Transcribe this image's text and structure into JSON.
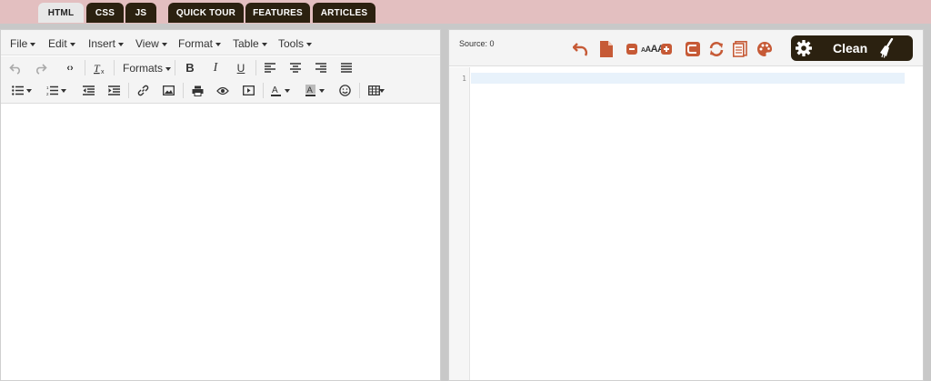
{
  "tabs": [
    {
      "label": "HTML",
      "active": true
    },
    {
      "label": "CSS",
      "active": false
    },
    {
      "label": "JS",
      "active": false
    },
    {
      "label": "QUICK TOUR",
      "active": false
    },
    {
      "label": "FEATURES",
      "active": false
    },
    {
      "label": "ARTICLES",
      "active": false
    }
  ],
  "menu": [
    "File",
    "Edit",
    "Insert",
    "View",
    "Format",
    "Table",
    "Tools"
  ],
  "toolbar": {
    "formats_label": "Formats",
    "icons_row1": [
      "undo-icon",
      "redo-icon",
      "source-code-icon",
      "clear-formatting-icon",
      "bold-icon",
      "italic-icon",
      "underline-icon",
      "align-left-icon",
      "align-center-icon",
      "align-right-icon",
      "justify-icon"
    ],
    "icons_row2": [
      "bullet-list-icon",
      "numbered-list-icon",
      "outdent-icon",
      "indent-icon",
      "link-icon",
      "image-icon",
      "print-icon",
      "preview-icon",
      "media-icon",
      "text-color-icon",
      "background-color-icon",
      "emoticons-icon",
      "table-icon"
    ]
  },
  "source": {
    "label": "Source: 0",
    "font_size_label": "AAA",
    "clean_label": "Clean",
    "line_number": "1",
    "accent_color": "#c65a36",
    "dark_color": "#2b2110"
  }
}
